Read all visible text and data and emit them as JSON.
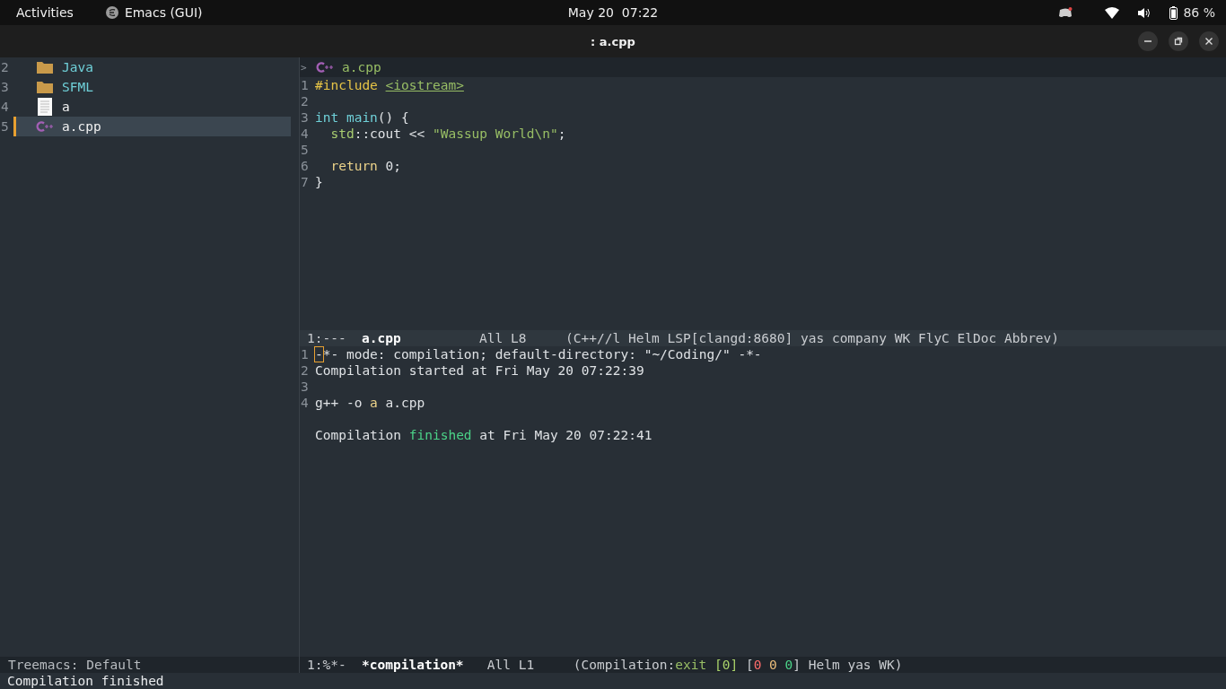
{
  "topbar": {
    "activities": "Activities",
    "app": "Emacs (GUI)",
    "clock": "May 20  07:22",
    "battery": "86 %"
  },
  "window": {
    "title": ": a.cpp"
  },
  "treemacs": {
    "items": [
      {
        "number": "2",
        "kind": "folder",
        "label": "Java",
        "selected": false
      },
      {
        "number": "3",
        "kind": "folder",
        "label": "SFML",
        "selected": false
      },
      {
        "number": "4",
        "kind": "file",
        "label": "a",
        "selected": false
      },
      {
        "number": "5",
        "kind": "cpp",
        "label": "a.cpp",
        "selected": true
      }
    ],
    "mode_line": "Treemacs: Default"
  },
  "editor": {
    "header": {
      "marker": ">",
      "file": "a.cpp"
    },
    "lines": [
      {
        "number": "1",
        "segments": [
          {
            "kind": "preproc",
            "text": "#include "
          },
          {
            "kind": "link",
            "text": "<iostream>"
          }
        ]
      },
      {
        "number": "2"
      },
      {
        "number": "3",
        "segments": [
          {
            "kind": "type",
            "text": "int "
          },
          {
            "kind": "func",
            "text": "main"
          },
          {
            "kind": "plain",
            "text": "() {"
          }
        ]
      },
      {
        "number": "4",
        "segments": [
          {
            "kind": "ns",
            "text": "  std"
          },
          {
            "kind": "plain",
            "text": "::cout << "
          },
          {
            "kind": "string",
            "text": "\"Wassup World\\n\""
          },
          {
            "kind": "plain",
            "text": ";"
          }
        ]
      },
      {
        "number": "5"
      },
      {
        "number": "6",
        "segments": [
          {
            "kind": "keyword",
            "text": "  return "
          },
          {
            "kind": "plain",
            "text": "0;"
          }
        ]
      },
      {
        "number": "7",
        "segments": [
          {
            "kind": "plain",
            "text": "}"
          }
        ]
      }
    ],
    "mode_line": [
      {
        "kind": "dim",
        "text": "1:---  "
      },
      {
        "kind": "bold",
        "text": "a.cpp"
      },
      {
        "kind": "dim",
        "text": "          All L8     (C++//l Helm LSP[clangd:8680] yas company WK FlyC ElDoc Abbrev)"
      }
    ]
  },
  "compilation": {
    "lines": [
      {
        "number": "1",
        "segments": [
          {
            "kind": "cursor",
            "text": "-"
          },
          {
            "kind": "plain",
            "text": "*- mode: compilation; default-directory: \"~/Coding/\" -*-"
          }
        ]
      },
      {
        "number": "2",
        "segments": [
          {
            "kind": "plain",
            "text": "Compilation started at Fri May 20 07:22:39"
          }
        ]
      },
      {
        "number": "3"
      },
      {
        "number": "4",
        "segments": [
          {
            "kind": "plain",
            "text": "g++ -o "
          },
          {
            "kind": "keyword",
            "text": "a"
          },
          {
            "kind": "plain",
            "text": " a.cpp"
          }
        ]
      },
      {
        "segments": [
          {
            "kind": "plain",
            "text": "\nCompilation "
          },
          {
            "kind": "success",
            "text": "finished"
          },
          {
            "kind": "plain",
            "text": " at Fri May 20 07:22:41"
          }
        ]
      }
    ],
    "mode_line": [
      {
        "kind": "dim",
        "text": "1:%*-  "
      },
      {
        "kind": "bold",
        "text": "*compilation*"
      },
      {
        "kind": "dim",
        "text": "   All L1     (Compilation:"
      },
      {
        "kind": "exit",
        "text": "exit"
      },
      {
        "kind": "code",
        "text": " [0]"
      },
      {
        "kind": "dim",
        "text": " ["
      },
      {
        "kind": "error",
        "text": "0"
      },
      {
        "kind": "warning",
        "text": " 0"
      },
      {
        "kind": "info",
        "text": " 0"
      },
      {
        "kind": "dim",
        "text": "] Helm yas WK)"
      }
    ]
  },
  "echo_area": "Compilation finished"
}
